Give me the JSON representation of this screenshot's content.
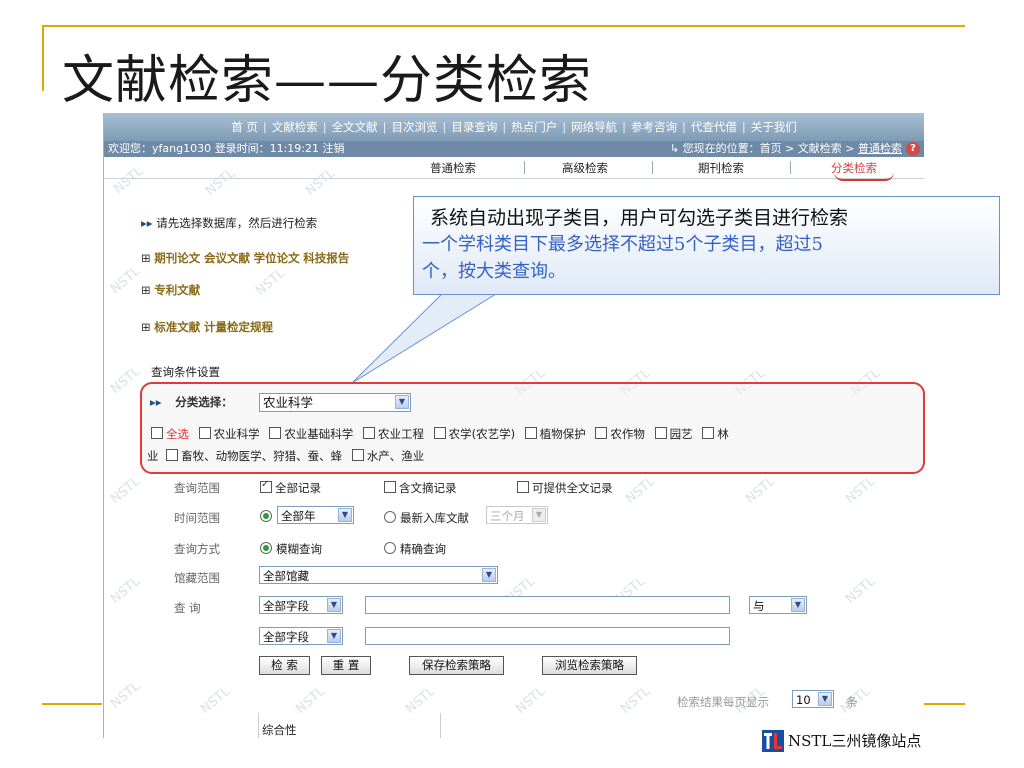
{
  "slide": {
    "title": "文献检索——分类检索",
    "footer_logo_text": "NSTL三州镜像站点"
  },
  "nav": {
    "items": [
      "首 页",
      "文献检索",
      "全文文献",
      "目次浏览",
      "目录查询",
      "热点门户",
      "网络导航",
      "参考咨询",
      "代查代借",
      "关于我们"
    ]
  },
  "status": {
    "welcome": "欢迎您：yfang1030 登录时间：11:19:21",
    "logout": "注销",
    "location_prefix": "↳ 您现在的位置：首页 > 文献检索 > ",
    "location_current": "普通检索"
  },
  "tabs": [
    "普通检索",
    "高级检索",
    "期刊检索",
    "分类检索"
  ],
  "watermark": "NSTL",
  "instruction": "请先选择数据库，然后进行检索",
  "databases": {
    "row1": [
      "期刊论文",
      "会议文献",
      "学位论文",
      "科技报告"
    ],
    "row2": [
      "专利文献"
    ],
    "row3": [
      "标准文献",
      "计量检定规程"
    ]
  },
  "callout": {
    "line1": "系统自动出现子类目，用户可勾选子类目进行检索",
    "line2": "一个学科类目下最多选择不超过5个子类目，超过5",
    "line3": "个，按大类查询。"
  },
  "query_settings_label": "查询条件设置",
  "classification": {
    "label": "分类选择：",
    "selected": "农业科学",
    "select_all": "全选",
    "subcategories_row1": [
      "农业科学",
      "农业基础科学",
      "农业工程",
      "农学(农艺学)",
      "植物保护",
      "农作物",
      "园艺",
      "林"
    ],
    "row2_prefix": "业",
    "subcategories_row2": [
      "畜牧、动物医学、狩猎、蚕、蜂",
      "水产、渔业"
    ]
  },
  "form": {
    "scope_label": "查询范围",
    "scope_options": [
      "全部记录",
      "含文摘记录",
      "可提供全文记录"
    ],
    "time_label": "时间范围",
    "time_all": "全部年",
    "time_recent": "最新入库文献",
    "time_recent_value": "三个月",
    "method_label": "查询方式",
    "method_options": [
      "模糊查询",
      "精确查询"
    ],
    "holdings_label": "馆藏范围",
    "holdings_value": "全部馆藏",
    "query_label": "查  询",
    "field1": "全部字段",
    "field2": "全部字段",
    "logic": "与",
    "buttons": {
      "search": "检 索",
      "reset": "重 置",
      "save_strategy": "保存检索策略",
      "browse_strategy": "浏览检索策略"
    },
    "per_page_label": "检索结果每页显示",
    "per_page_value": "10",
    "per_page_unit": "条",
    "bottom_item": "综合性"
  }
}
